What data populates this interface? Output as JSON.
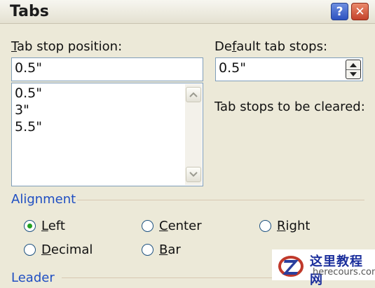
{
  "window": {
    "title": "Tabs"
  },
  "titlebar_buttons": {
    "help": "?",
    "close": "✕"
  },
  "tab_stop": {
    "label_hotkey": "T",
    "label_rest": "ab stop position:",
    "value": "0.5\"",
    "list": [
      "0.5\"",
      "3\"",
      "5.5\""
    ]
  },
  "default_tabs": {
    "label_hotkey": "f",
    "label_pre": "De",
    "label_post": "ault tab stops:",
    "value": "0.5\""
  },
  "cleared": {
    "label": "Tab stops to be cleared:"
  },
  "alignment": {
    "title": "Alignment",
    "options": [
      {
        "hotkey": "L",
        "rest": "eft",
        "checked": true
      },
      {
        "hotkey": "C",
        "rest": "enter",
        "checked": false
      },
      {
        "hotkey": "R",
        "rest": "ight",
        "checked": false
      },
      {
        "hotkey": "D",
        "rest": "ecimal",
        "checked": false
      },
      {
        "hotkey": "B",
        "rest": "ar",
        "checked": false
      }
    ]
  },
  "leader": {
    "title": "Leader"
  },
  "watermark": {
    "text_cn": "这里教程网",
    "text_en": "herecours.com"
  },
  "icons": {
    "scroll_up": "up-arrow",
    "scroll_down": "down-arrow",
    "spin": "spinner"
  }
}
